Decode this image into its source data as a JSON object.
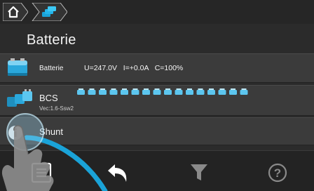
{
  "header": {
    "title": "Batterie"
  },
  "rows": [
    {
      "label": "Batterie",
      "values": "U=247.0V   I=+0.0A   C=100%",
      "icon": "battery-icon"
    },
    {
      "label": "BCS",
      "subtitle": "Vec:1.6-Ssw2",
      "icon": "battery-cells-icon",
      "cell_count": 16
    },
    {
      "label": "Shunt",
      "icon": "info-icon"
    }
  ],
  "bottom_bar": {
    "buttons": [
      "menu-icon",
      "back-arrow-icon",
      "filter-icon",
      "help-icon"
    ],
    "help_glyph": "?"
  },
  "colors": {
    "accent": "#1aa3d8",
    "background": "#2b2b2b",
    "row": "#3b3b3b"
  }
}
